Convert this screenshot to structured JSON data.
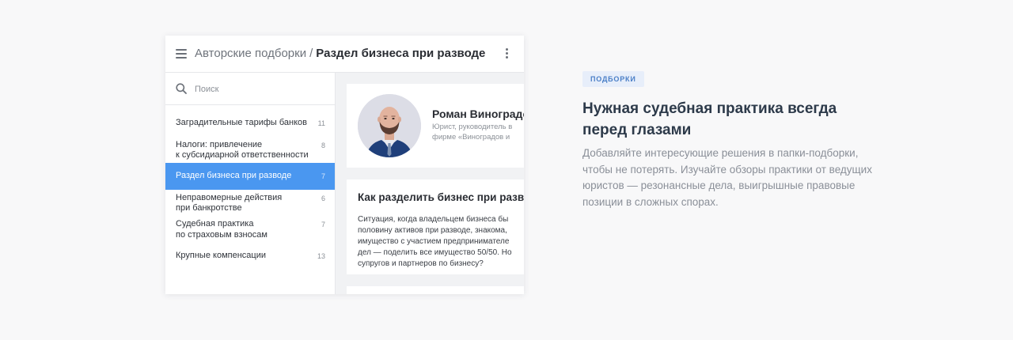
{
  "header": {
    "breadcrumb_root": "Авторские подборки",
    "breadcrumb_separator": "/",
    "breadcrumb_current": "Раздел бизнеса при разводе",
    "menu_icon": "hamburger-icon",
    "more_icon": "more-vertical-icon"
  },
  "sidebar": {
    "search_placeholder": "Поиск",
    "items": [
      {
        "line1": "Заградительные тарифы банков",
        "line2": "",
        "count": "11",
        "active": false
      },
      {
        "line1": "Налоги: привлечение",
        "line2": "к субсидиарной ответственности",
        "count": "8",
        "active": false
      },
      {
        "line1": "Раздел бизнеса при разводе",
        "line2": "",
        "count": "7",
        "active": true
      },
      {
        "line1": "Неправомерные действия",
        "line2": "при банкротстве",
        "count": "6",
        "active": false
      },
      {
        "line1": "Судебная практика",
        "line2": "по страховым взносам",
        "count": "7",
        "active": false
      },
      {
        "line1": "Крупные компенсации",
        "line2": "",
        "count": "13",
        "active": false
      }
    ]
  },
  "author": {
    "name": "Роман Виноградов",
    "role_line1": "Юрист, руководитель в",
    "role_line2": "фирме «Виноградов и"
  },
  "article": {
    "title": "Как разделить бизнес при разводе",
    "lines": [
      "Ситуация, когда владельцем бизнеса бы",
      "половину активов при разводе, знакома,",
      "имущество с участием предпринимателе",
      "дел — поделить все имущество 50/50. Но",
      "супругов и партнеров по бизнесу?"
    ]
  },
  "promo": {
    "badge": "ПОДБОРКИ",
    "headline_line1": "Нужная судебная практика всегда",
    "headline_line2": "перед глазами",
    "desc_lines": [
      "Добавляйте интересующие решения в папки-подборки,",
      "чтобы не потерять. Изучайте обзоры практики от ведущих",
      "юристов — резонансные дела, выигрышные правовые",
      "позиции в сложных спорах."
    ]
  },
  "colors": {
    "accent": "#4a97f0",
    "badge_bg": "#e7eefa",
    "badge_text": "#4a7fc7",
    "page_bg": "#f8f8f9"
  }
}
